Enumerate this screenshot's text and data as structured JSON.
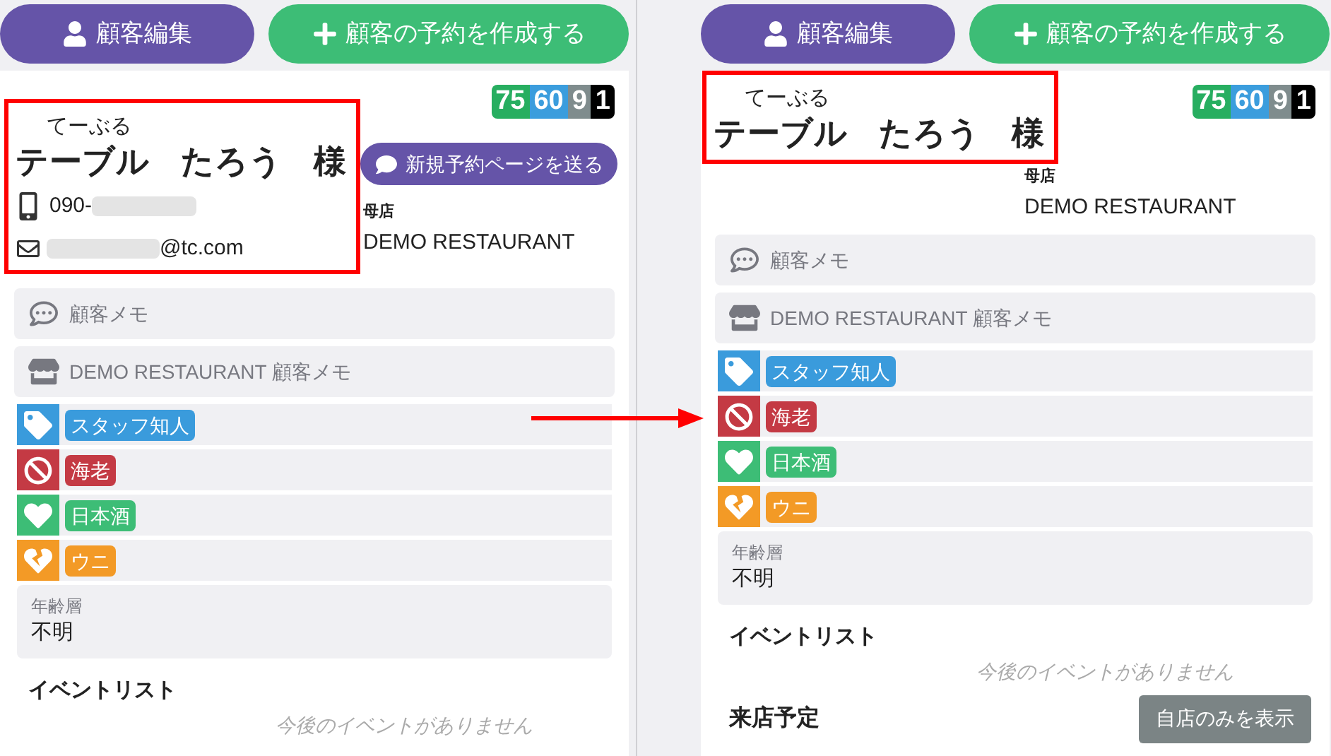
{
  "panels": [
    {
      "edit_button": "顧客編集",
      "create_button": "顧客の予約を作成する",
      "scores": [
        {
          "value": "75",
          "color": "#27ae60"
        },
        {
          "value": "60",
          "color": "#3b9ddd"
        },
        {
          "value": "9",
          "color": "#7f8c8d"
        },
        {
          "value": "1",
          "color": "#000000"
        }
      ],
      "highlight": true,
      "furigana": "てーぶる",
      "last_name": "テーブル",
      "first_name": "たろう",
      "honorific": "様",
      "send_button": "新規予約ページを送る",
      "phone": "090-",
      "email": "@tc.com",
      "home_store_label": "母店",
      "home_store": "DEMO RESTAURANT",
      "memos": [
        {
          "kind": "chat",
          "text": "顧客メモ"
        },
        {
          "kind": "store",
          "text": "DEMO RESTAURANT 顧客メモ"
        }
      ],
      "tags": [
        {
          "kind": "tag",
          "label": "スタッフ知人",
          "color": "#3a9bdc"
        },
        {
          "kind": "ban",
          "label": "海老",
          "color": "#c43a44"
        },
        {
          "kind": "like",
          "label": "日本酒",
          "color": "#3dbd76"
        },
        {
          "kind": "dislike",
          "label": "ウニ",
          "color": "#f39a26"
        }
      ],
      "age_label": "年齢層",
      "age": "不明",
      "events_title": "イベントリスト",
      "events_empty": "今後のイベントがありません"
    },
    {
      "edit_button": "顧客編集",
      "create_button": "顧客の予約を作成する",
      "scores": [
        {
          "value": "75",
          "color": "#27ae60"
        },
        {
          "value": "60",
          "color": "#3b9ddd"
        },
        {
          "value": "9",
          "color": "#7f8c8d"
        },
        {
          "value": "1",
          "color": "#000000"
        }
      ],
      "highlight": true,
      "furigana": "てーぶる",
      "last_name": "テーブル",
      "first_name": "たろう",
      "honorific": "様",
      "home_store_label": "母店",
      "home_store": "DEMO RESTAURANT",
      "memos": [
        {
          "kind": "chat",
          "text": "顧客メモ"
        },
        {
          "kind": "store",
          "text": "DEMO RESTAURANT 顧客メモ"
        }
      ],
      "tags": [
        {
          "kind": "tag",
          "label": "スタッフ知人",
          "color": "#3a9bdc"
        },
        {
          "kind": "ban",
          "label": "海老",
          "color": "#c43a44"
        },
        {
          "kind": "like",
          "label": "日本酒",
          "color": "#3dbd76"
        },
        {
          "kind": "dislike",
          "label": "ウニ",
          "color": "#f39a26"
        }
      ],
      "age_label": "年齢層",
      "age": "不明",
      "events_title": "イベントリスト",
      "events_empty": "今後のイベントがありません",
      "visits_title": "来店予定",
      "own_store_button": "自店のみを表示"
    }
  ]
}
